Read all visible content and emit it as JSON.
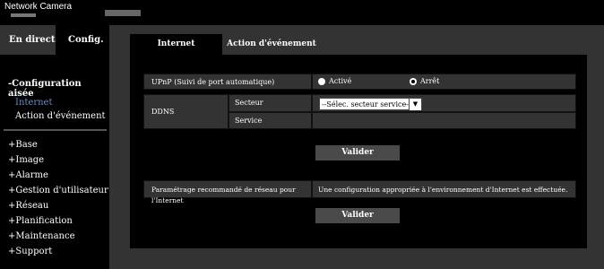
{
  "header": {
    "brand": "Network Camera"
  },
  "nav": {
    "live_tab": "En direct",
    "config_tab": "Config."
  },
  "sidebar": {
    "quick_setup_title": "-Configuration aisée",
    "quick_items": [
      "Internet",
      "Action d'événement"
    ],
    "menu": [
      "+Base",
      "+Image",
      "+Alarme",
      "+Gestion d'utilisateur",
      "+Réseau",
      "+Planification",
      "+Maintenance",
      "+Support"
    ]
  },
  "tabs": {
    "internet": "Internet",
    "event_action": "Action d'événement"
  },
  "upnp": {
    "label": "UPnP (Suivi de port automatique)",
    "option_on": "Activé",
    "option_off": "Arrêt",
    "selected": "Arrêt"
  },
  "ddns": {
    "label": "DDNS",
    "sector_label": "Secteur",
    "sector_value": "--Sélec. secteur service--",
    "service_label": "Service",
    "service_value": ""
  },
  "buttons": {
    "validate": "Valider"
  },
  "recommended": {
    "label": "Paramétrage recommandé de réseau pour l'Internet",
    "message": "Une configuration appropriée à l'environnement d'Internet est effectuée."
  },
  "colors": {
    "background": "#000000",
    "panel_cell": "#333333",
    "active_link": "#6a8cc8",
    "button": "#4a4a4a"
  }
}
